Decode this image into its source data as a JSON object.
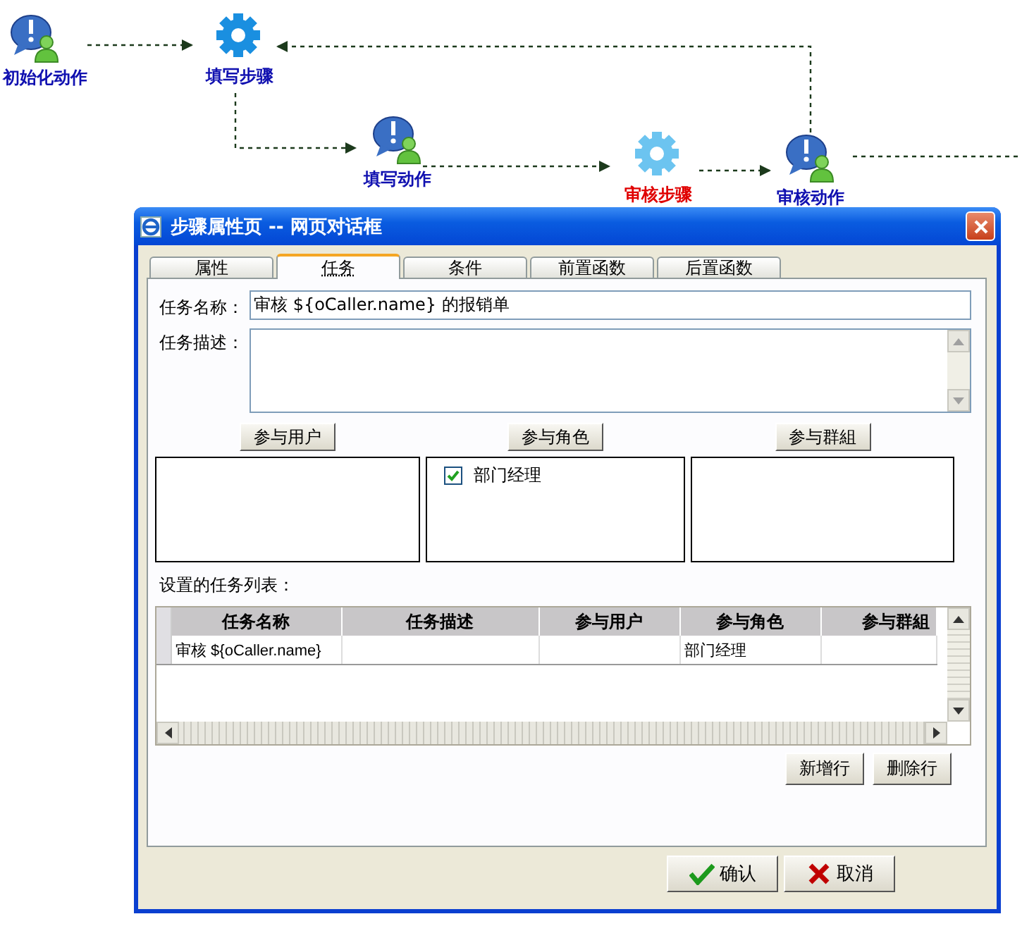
{
  "flow": {
    "nodes": [
      {
        "kind": "action",
        "label": "初始化动作",
        "selected": false
      },
      {
        "kind": "step",
        "label": "填写步骤",
        "selected": false
      },
      {
        "kind": "action",
        "label": "填写动作",
        "selected": false
      },
      {
        "kind": "step",
        "label": "审核步骤",
        "selected": true
      },
      {
        "kind": "action",
        "label": "审核动作",
        "selected": false
      }
    ]
  },
  "dialog": {
    "title": "步骤属性页 -- 网页对话框",
    "tabs": [
      {
        "label": "属性",
        "selected": false
      },
      {
        "label": "任务",
        "selected": true
      },
      {
        "label": "条件",
        "selected": false
      },
      {
        "label": "前置函数",
        "selected": false
      },
      {
        "label": "后置函数",
        "selected": false
      }
    ],
    "task_name": {
      "label": "任务名称：",
      "value": "审核 ${oCaller.name} 的报销单"
    },
    "task_description": {
      "label": "任务描述："
    },
    "participants": [
      {
        "button": "参与用户"
      },
      {
        "button": "参与角色",
        "items": [
          {
            "label": "部门经理",
            "checked": true
          }
        ]
      },
      {
        "button": "参与群組"
      }
    ],
    "task_list": {
      "label": "设置的任务列表：",
      "columns": [
        "任务名称",
        "任务描述",
        "参与用户",
        "参与角色",
        "参与群組"
      ],
      "rows": [
        [
          "审核 ${oCaller.name}",
          "",
          "",
          "部门经理",
          ""
        ]
      ]
    },
    "row_buttons": [
      "新增行",
      "删除行"
    ],
    "buttons": [
      {
        "kind": "ok",
        "label": "确认"
      },
      {
        "kind": "cancel",
        "label": "取消"
      }
    ]
  }
}
